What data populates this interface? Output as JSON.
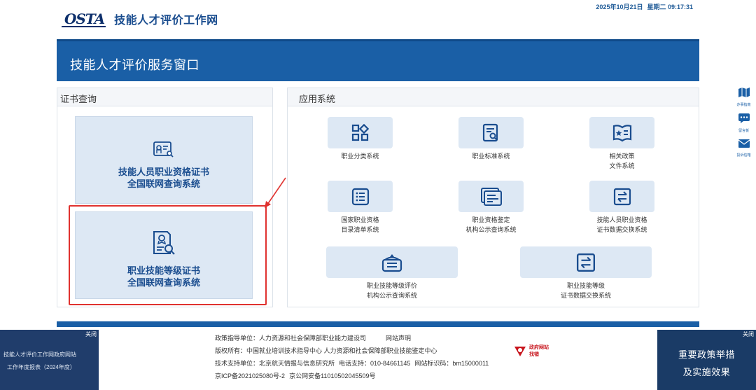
{
  "header": {
    "date": "2025年10月21日",
    "weekday_time": "星期二 09:17:31",
    "logo_text": "OSTA",
    "site_title": "技能人才评价工作网"
  },
  "banner": {
    "title": "技能人才评价服务窗口"
  },
  "cert_query": {
    "heading": "证书查询",
    "items": [
      {
        "line1": "技能人员职业资格证书",
        "line2": "全国联网查询系统"
      },
      {
        "line1": "职业技能等级证书",
        "line2": "全国联网查询系统"
      }
    ]
  },
  "apps": {
    "heading": "应用系统",
    "items": [
      {
        "label": "职业分类系统",
        "icon": "grid-apps-icon"
      },
      {
        "label": "职业标准系统",
        "icon": "document-search-icon"
      },
      {
        "label": "相关政策\n文件系统",
        "icon": "star-book-icon"
      },
      {
        "label": "国家职业资格\n目录清单系统",
        "icon": "list-icon"
      },
      {
        "label": "职业资格鉴定\n机构公示查询系统",
        "icon": "cards-icon"
      },
      {
        "label": "技能人员职业资格\n证书数据交换系统",
        "icon": "exchange-icon"
      },
      {
        "label": "职业技能等级评价\n机构公示查询系统",
        "icon": "building-icon"
      },
      {
        "label": "职业技能等级\n证书数据交换系统",
        "icon": "exchange-icon"
      }
    ]
  },
  "footer": {
    "line1_a": "政策指导单位：人力资源和社会保障部职业能力建设司",
    "line1_b": "网站声明",
    "line2": "版权所有：中国就业培训技术指导中心 人力资源和社会保障部职业技能鉴定中心",
    "line3_a": "技术支持单位：北京航天情报与信息研究所",
    "line3_b": "电话支持：010-84661145",
    "line3_c": "网站标识码：bm15000011",
    "line4_a": "京ICP备2021025080号-2",
    "line4_b": "京公网安备11010502045509号",
    "gov_badge_1": "政府网站",
    "gov_badge_2": "找错"
  },
  "float_left": {
    "close": "关闭",
    "line1": "技能人才评价工作网政府网站",
    "line2": "工作年度报表（2024年度）"
  },
  "float_right": {
    "close": "关闭",
    "line1": "重要政策举措",
    "line2": "及实施效果"
  },
  "side_bar": [
    {
      "label": "办事指南",
      "icon": "map-icon"
    },
    {
      "label": "留言板",
      "icon": "chat-icon"
    },
    {
      "label": "投诉信箱",
      "icon": "mail-icon"
    }
  ],
  "colors": {
    "primary": "#1a5fa6",
    "title": "#1a4d8f",
    "tile_bg": "#dde8f4",
    "highlight": "#e0322f"
  }
}
